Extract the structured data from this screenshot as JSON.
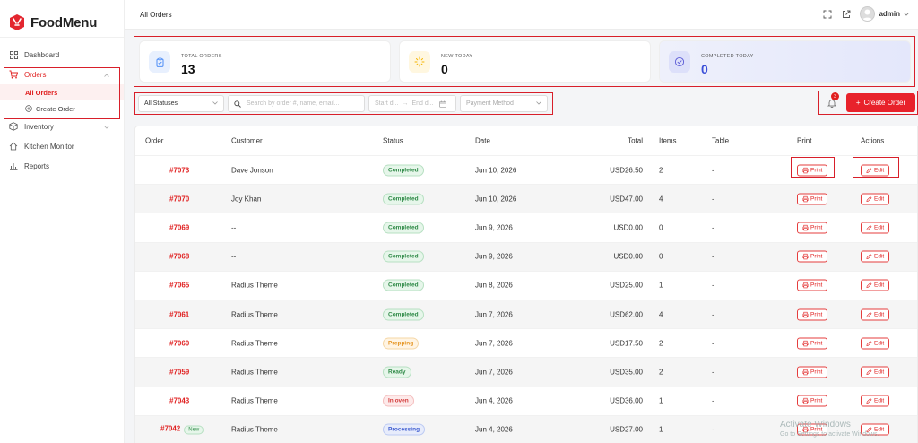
{
  "app": {
    "name": "FoodMenu"
  },
  "sidebar": {
    "items": [
      {
        "label": "Dashboard",
        "icon": "grid-icon"
      },
      {
        "label": "Orders",
        "icon": "cart-icon",
        "active": true,
        "children": [
          {
            "label": "All Orders",
            "active": true
          },
          {
            "label": "Create Order",
            "icon": "plus-circle-icon"
          }
        ]
      },
      {
        "label": "Inventory",
        "icon": "box-icon"
      },
      {
        "label": "Kitchen Monitor",
        "icon": "chef-hat-icon"
      },
      {
        "label": "Reports",
        "icon": "bar-chart-icon"
      }
    ]
  },
  "topbar": {
    "title": "All Orders",
    "user": "admin"
  },
  "stats": [
    {
      "label": "TOTAL ORDERS",
      "value": "13",
      "icon": "clipboard-icon",
      "color": "#3b82f6"
    },
    {
      "label": "NEW TODAY",
      "value": "0",
      "icon": "spinner-icon",
      "color": "#f5b400"
    },
    {
      "label": "COMPLETED TODAY",
      "value": "0",
      "icon": "check-circle-icon",
      "color": "#5b5bd6"
    }
  ],
  "filters": {
    "status": "All Statuses",
    "search_placeholder": "Search by order #, name, email...",
    "start_placeholder": "Start d...",
    "arrow": "→",
    "end_placeholder": "End d...",
    "payment": "Payment Method"
  },
  "notifications": {
    "count": "3"
  },
  "create_button": {
    "label": "Create Order",
    "plus": "+"
  },
  "table": {
    "columns": [
      "Order",
      "Customer",
      "Status",
      "Date",
      "Total",
      "Items",
      "Table",
      "Print",
      "Actions"
    ],
    "print_label": "Print",
    "edit_label": "Edit",
    "rows": [
      {
        "order": "#7073",
        "customer": "Dave Jonson",
        "status": "Completed",
        "kind": "completed",
        "date": "Jun 10, 2026",
        "total": "USD26.50",
        "items": "2",
        "table": "-"
      },
      {
        "order": "#7070",
        "customer": "Joy Khan",
        "status": "Completed",
        "kind": "completed",
        "date": "Jun 10, 2026",
        "total": "USD47.00",
        "items": "4",
        "table": "-"
      },
      {
        "order": "#7069",
        "customer": "--",
        "status": "Completed",
        "kind": "completed",
        "date": "Jun 9, 2026",
        "total": "USD0.00",
        "items": "0",
        "table": "-"
      },
      {
        "order": "#7068",
        "customer": "--",
        "status": "Completed",
        "kind": "completed",
        "date": "Jun 9, 2026",
        "total": "USD0.00",
        "items": "0",
        "table": "-"
      },
      {
        "order": "#7065",
        "customer": "Radius Theme",
        "status": "Completed",
        "kind": "completed",
        "date": "Jun 8, 2026",
        "total": "USD25.00",
        "items": "1",
        "table": "-"
      },
      {
        "order": "#7061",
        "customer": "Radius Theme",
        "status": "Completed",
        "kind": "completed",
        "date": "Jun 7, 2026",
        "total": "USD62.00",
        "items": "4",
        "table": "-"
      },
      {
        "order": "#7060",
        "customer": "Radius Theme",
        "status": "Prepping",
        "kind": "prepping",
        "date": "Jun 7, 2026",
        "total": "USD17.50",
        "items": "2",
        "table": "-"
      },
      {
        "order": "#7059",
        "customer": "Radius Theme",
        "status": "Ready",
        "kind": "ready",
        "date": "Jun 7, 2026",
        "total": "USD35.00",
        "items": "2",
        "table": "-"
      },
      {
        "order": "#7043",
        "customer": "Radius Theme",
        "status": "In oven",
        "kind": "oven",
        "date": "Jun 4, 2026",
        "total": "USD36.00",
        "items": "1",
        "table": "-"
      },
      {
        "order": "#7042",
        "customer": "Radius Theme",
        "status": "Processing",
        "kind": "processing",
        "date": "Jun 4, 2026",
        "total": "USD27.00",
        "items": "1",
        "table": "-",
        "tag": "New"
      }
    ]
  },
  "watermark": {
    "line1": "Activate Windows",
    "line2": "Go to Settings to activate Windows."
  }
}
